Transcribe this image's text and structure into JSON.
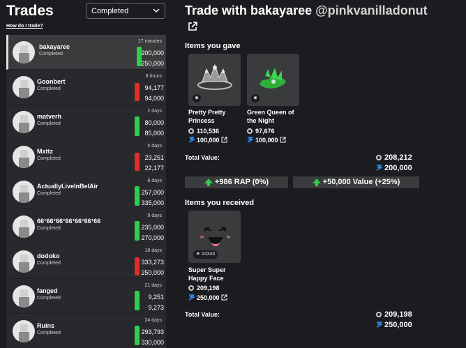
{
  "left": {
    "title": "Trades",
    "status_filter": "Completed",
    "help_link": "How do I trade?"
  },
  "trades": [
    {
      "user": "bakayaree",
      "status": "Completed",
      "time": "17 minutes",
      "give": "200,000",
      "get": "250,000",
      "trend": "up",
      "active": true
    },
    {
      "user": "Goonbert",
      "status": "Completed",
      "time": "8 hours",
      "give": "94,177",
      "get": "94,000",
      "trend": "down"
    },
    {
      "user": "matverh",
      "status": "Completed",
      "time": "2 days",
      "give": "80,000",
      "get": "85,000",
      "trend": "up"
    },
    {
      "user": "Mxttz",
      "status": "Completed",
      "time": "5 days",
      "give": "23,251",
      "get": "22,177",
      "trend": "down"
    },
    {
      "user": "ActuallyLiveInBelAir",
      "status": "Completed",
      "time": "8 days",
      "give": "257,000",
      "get": "335,000",
      "trend": "up"
    },
    {
      "user": "66ᐩ66ᐩ66ᐩ66ᐩ66ᐩ66ᐩ66",
      "status": "Completed",
      "time": "9 days",
      "give": "235,000",
      "get": "270,000",
      "trend": "up"
    },
    {
      "user": "dodoko",
      "status": "Completed",
      "time": "18 days",
      "give": "333,273",
      "get": "250,000",
      "trend": "down"
    },
    {
      "user": "fanged",
      "status": "Completed",
      "time": "21 days",
      "give": "9,251",
      "get": "9,273",
      "trend": "up"
    },
    {
      "user": "Ruins",
      "status": "Completed",
      "time": "24 days",
      "give": "293,793",
      "get": "330,000",
      "trend": "up"
    }
  ],
  "detail": {
    "title": "Trade with bakayaree",
    "handle": "@pinkvanilladonut",
    "gave_heading": "Items you gave",
    "received_heading": "Items you received",
    "total_label": "Total Value:",
    "gave_items": [
      {
        "name": "Pretty Pretty Princess",
        "rap": "110,536",
        "value": "100,000",
        "icon": "tiara-icon"
      },
      {
        "name": "Green Queen of the Night",
        "rap": "97,676",
        "value": "100,000",
        "icon": "green-crown-icon"
      }
    ],
    "gave_total_rap": "208,212",
    "gave_total_value": "200,000",
    "rap_diff": "+986 RAP (0%)",
    "value_diff": "+50,000 Value (+25%)",
    "received_items": [
      {
        "name": "Super Super Happy Face",
        "rap": "209,198",
        "value": "250,000",
        "serial": "#4344",
        "icon": "happy-face-icon"
      }
    ],
    "received_total_rap": "209,198",
    "received_total_value": "250,000"
  },
  "colors": {
    "background": "#1a1c1f",
    "panel": "#27292d",
    "card": "#393b3d",
    "gain": "#2bd14a",
    "loss": "#e62b2b",
    "value_icon": "#2b8ef7"
  }
}
